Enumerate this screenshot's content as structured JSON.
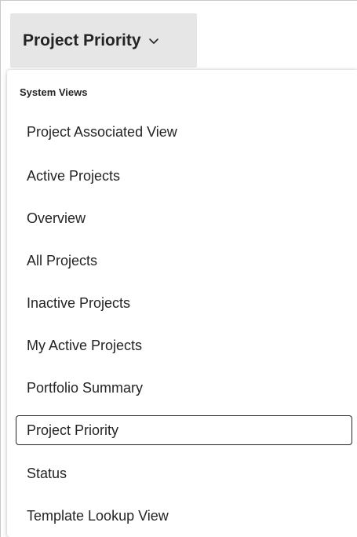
{
  "view_selector": {
    "label": "Project Priority",
    "icon": "chevron-down-icon"
  },
  "menu": {
    "group_header": "System Views",
    "items": [
      {
        "label": "Project Associated View",
        "selected": false
      },
      {
        "label": "Active Projects",
        "selected": false
      },
      {
        "label": "Overview",
        "selected": false
      },
      {
        "label": "All Projects",
        "selected": false
      },
      {
        "label": "Inactive Projects",
        "selected": false
      },
      {
        "label": "My Active Projects",
        "selected": false
      },
      {
        "label": "Portfolio Summary",
        "selected": false
      },
      {
        "label": "Project Priority",
        "selected": true
      },
      {
        "label": "Status",
        "selected": false
      },
      {
        "label": "Template Lookup View",
        "selected": false
      }
    ]
  }
}
